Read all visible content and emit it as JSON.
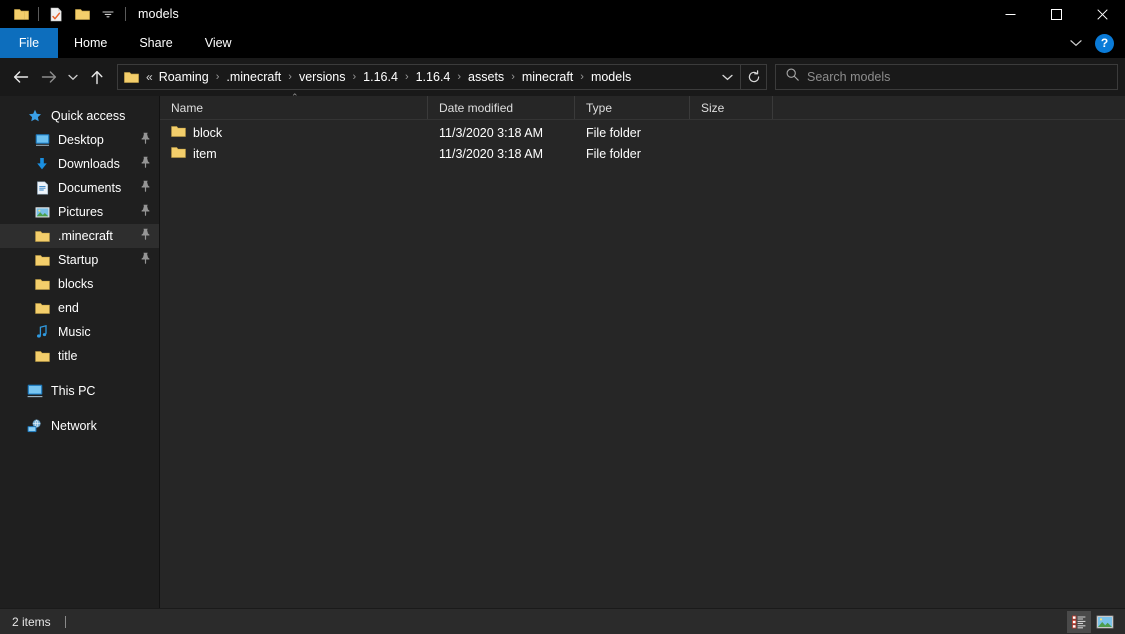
{
  "window": {
    "title": "models",
    "quick_access_toolbar": [
      {
        "name": "folder-icon",
        "label": "Explorer"
      },
      {
        "name": "properties-icon",
        "label": "Properties"
      },
      {
        "name": "new-folder-icon",
        "label": "New folder"
      },
      {
        "name": "chevron-down-icon",
        "label": "Customize Quick Access Toolbar"
      }
    ],
    "controls": {
      "minimize": "—",
      "maximize": "☐",
      "close": "✕"
    }
  },
  "ribbon": {
    "tabs": [
      {
        "label": "File",
        "active": true
      },
      {
        "label": "Home",
        "active": false
      },
      {
        "label": "Share",
        "active": false
      },
      {
        "label": "View",
        "active": false
      }
    ],
    "expand_label": "⌄",
    "help_label": "?"
  },
  "address": {
    "back_label": "←",
    "forward_label": "→",
    "recent_label": "⌄",
    "up_label": "↑",
    "overflow": "«",
    "crumbs": [
      "Roaming",
      ".minecraft",
      "versions",
      "1.16.4",
      "1.16.4",
      "assets",
      "minecraft",
      "models"
    ],
    "separator": "›",
    "dropdown_label": "⌄",
    "refresh_label": "↻"
  },
  "search": {
    "placeholder": "Search models",
    "value": ""
  },
  "sidebar": {
    "groups": [
      {
        "name": "quick-access",
        "header": {
          "label": "Quick access",
          "icon": "star-icon"
        },
        "items": [
          {
            "label": "Desktop",
            "icon": "desktop-icon",
            "pinned": true,
            "hovered": false
          },
          {
            "label": "Downloads",
            "icon": "download-icon",
            "pinned": true,
            "hovered": false
          },
          {
            "label": "Documents",
            "icon": "document-icon",
            "pinned": true,
            "hovered": false
          },
          {
            "label": "Pictures",
            "icon": "pictures-icon",
            "pinned": true,
            "hovered": false
          },
          {
            "label": ".minecraft",
            "icon": "folder-icon",
            "pinned": true,
            "hovered": true
          },
          {
            "label": "Startup",
            "icon": "folder-icon",
            "pinned": true,
            "hovered": false
          },
          {
            "label": "blocks",
            "icon": "folder-icon",
            "pinned": false,
            "hovered": false
          },
          {
            "label": "end",
            "icon": "folder-icon",
            "pinned": false,
            "hovered": false
          },
          {
            "label": "Music",
            "icon": "music-icon",
            "pinned": false,
            "hovered": false
          },
          {
            "label": "title",
            "icon": "folder-icon",
            "pinned": false,
            "hovered": false
          }
        ]
      },
      {
        "name": "this-pc",
        "header": {
          "label": "This PC",
          "icon": "this-pc-icon"
        },
        "items": []
      },
      {
        "name": "network",
        "header": {
          "label": "Network",
          "icon": "network-icon"
        },
        "items": []
      }
    ]
  },
  "filelist": {
    "columns": [
      {
        "key": "name",
        "label": "Name",
        "sorted": "asc"
      },
      {
        "key": "date",
        "label": "Date modified",
        "sorted": ""
      },
      {
        "key": "type",
        "label": "Type",
        "sorted": ""
      },
      {
        "key": "size",
        "label": "Size",
        "sorted": ""
      }
    ],
    "sort_caret": "⌃",
    "rows": [
      {
        "name": "block",
        "date": "11/3/2020 3:18 AM",
        "type": "File folder",
        "size": "",
        "icon": "folder-icon"
      },
      {
        "name": "item",
        "date": "11/3/2020 3:18 AM",
        "type": "File folder",
        "size": "",
        "icon": "folder-icon"
      }
    ]
  },
  "statusbar": {
    "item_count": "2 items",
    "views": [
      {
        "name": "details-view-button",
        "label": "Details view",
        "active": true
      },
      {
        "name": "large-icons-view-button",
        "label": "Large icons view",
        "active": false
      }
    ]
  },
  "colors": {
    "accent": "#0d6ebd",
    "titlebar_bg": "#000000",
    "sidebar_bg": "#1f1f1f",
    "content_bg": "#262626",
    "statusbar_bg": "#2b2b2b",
    "folder_yellow": "#f3ce6b",
    "text": "#ffffff"
  }
}
